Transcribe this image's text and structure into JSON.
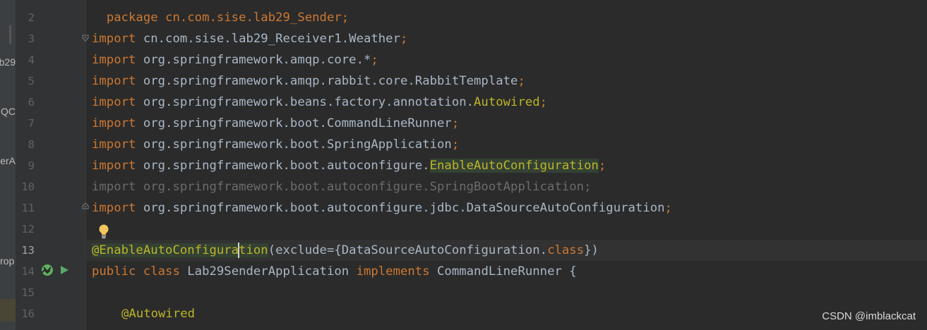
{
  "project_panel": {
    "labels": [
      "b29",
      "MQC",
      "lerA",
      "rop"
    ]
  },
  "editor": {
    "lines": [
      {
        "n": "",
        "html_id": "l0"
      },
      {
        "n": "2"
      },
      {
        "n": "3"
      },
      {
        "n": "4"
      },
      {
        "n": "5"
      },
      {
        "n": "6"
      },
      {
        "n": "7"
      },
      {
        "n": "8"
      },
      {
        "n": "9"
      },
      {
        "n": "10"
      },
      {
        "n": "11"
      },
      {
        "n": "12"
      },
      {
        "n": "13"
      },
      {
        "n": "14"
      },
      {
        "n": "15"
      },
      {
        "n": "16"
      }
    ],
    "code": {
      "l1": "package cn.com.sise.lab29_Sender;",
      "l3_kw": "import",
      "l3_path": " cn.com.sise.lab29_Receiver1.Weather",
      "semi": ";",
      "l4_kw": "import",
      "l4_path": " org.springframework.amqp.core.*",
      "l5_kw": "import",
      "l5_path": " org.springframework.amqp.rabbit.core.RabbitTemplate",
      "l6_kw": "import",
      "l6_path": " org.springframework.beans.factory.annotation.",
      "l6_ann": "Autowired",
      "l7_kw": "import",
      "l7_path": " org.springframework.boot.CommandLineRunner",
      "l8_kw": "import",
      "l8_path": " org.springframework.boot.SpringApplication",
      "l9_kw": "import",
      "l9_path": " org.springframework.boot.autoconfigure.",
      "l9_ann": "EnableAutoConfiguration",
      "l10_text": "import org.springframework.boot.autoconfigure.SpringBootApplication;",
      "l11_kw": "import",
      "l11_path": " org.springframework.boot.autoconfigure.jdbc.DataSourceAutoConfiguration",
      "l13_ann_a": "@EnableAutoConfigura",
      "l13_ann_b": "tion",
      "l13_rest": "(exclude={DataSourceAutoConfiguration.",
      "l13_kw": "class",
      "l13_end": "})",
      "l14_kw1": "public class",
      "l14_name": " Lab29SenderApplication ",
      "l14_kw2": "implements",
      "l14_rest": " CommandLineRunner {",
      "l16_ann": "@Autowired"
    }
  },
  "watermark": "CSDN @imblackcat",
  "colors": {
    "keyword": "#cc7832",
    "annotation": "#bbb529",
    "text": "#a9b7c6",
    "background": "#2b2b2b"
  },
  "icons": [
    "bulb-icon",
    "fold-icon",
    "run-gutter-icon",
    "implement-gutter-icon"
  ]
}
